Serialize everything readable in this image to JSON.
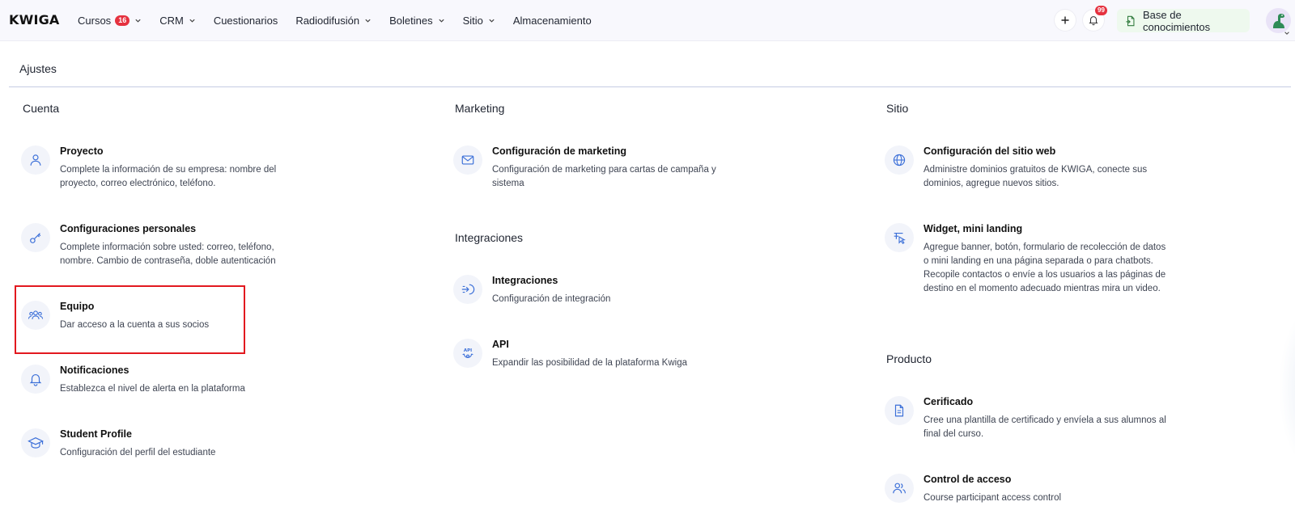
{
  "app": {
    "logo": "KWIGA"
  },
  "nav": {
    "items": [
      {
        "label": "Cursos",
        "badge": "16",
        "dropdown": true
      },
      {
        "label": "CRM",
        "dropdown": true
      },
      {
        "label": "Cuestionarios",
        "dropdown": false
      },
      {
        "label": "Radiodifusión",
        "dropdown": true
      },
      {
        "label": "Boletines",
        "dropdown": true
      },
      {
        "label": "Sitio",
        "dropdown": true
      },
      {
        "label": "Almacenamiento",
        "dropdown": false
      }
    ],
    "notifications_badge": "99",
    "knowledge_base_label": "Base de conocimientos"
  },
  "page": {
    "title": "Ajustes"
  },
  "sections": {
    "cuenta": {
      "title": "Cuenta",
      "items": [
        {
          "icon": "user-icon",
          "title": "Proyecto",
          "desc": "Complete la información de su empresa: nombre del proyecto, correo electrónico, teléfono."
        },
        {
          "icon": "key-icon",
          "title": "Configuraciones personales",
          "desc": "Complete información sobre usted: correo, teléfono, nombre. Cambio de contraseña, doble autenticación"
        },
        {
          "icon": "team-icon",
          "title": "Equipo",
          "desc": "Dar acceso a la cuenta a sus socios"
        },
        {
          "icon": "bell-icon",
          "title": "Notificaciones",
          "desc": "Establezca el nivel de alerta en la plataforma"
        },
        {
          "icon": "graduation-cap-icon",
          "title": "Student Profile",
          "desc": "Configuración del perfil del estudiante"
        }
      ]
    },
    "marketing": {
      "title": "Marketing",
      "items": [
        {
          "icon": "mail-icon",
          "title": "Configuración de marketing",
          "desc": "Configuración de marketing para cartas de campaña y sistema"
        }
      ]
    },
    "integraciones": {
      "title": "Integraciones",
      "items": [
        {
          "icon": "integration-icon",
          "title": "Integraciones",
          "desc": "Configuración de integración"
        },
        {
          "icon": "api-icon",
          "title": "API",
          "desc": "Expandir las posibilidad de la plataforma Kwiga"
        }
      ]
    },
    "sitio": {
      "title": "Sitio",
      "items": [
        {
          "icon": "globe-icon",
          "title": "Configuración del sitio web",
          "desc": "Administre dominios gratuitos de KWIGA, conecte sus dominios, agregue nuevos sitios."
        },
        {
          "icon": "widget-icon",
          "title": "Widget, mini landing",
          "desc": "Agregue banner, botón, formulario de recolección de datos o mini landing en una página separada o para chatbots. Recopile contactos o envíe a los usuarios a las páginas de destino en el momento adecuado mientras mira un video."
        }
      ]
    },
    "producto": {
      "title": "Producto",
      "items": [
        {
          "icon": "certificate-icon",
          "title": "Cerificado",
          "desc": "Cree una plantilla de certificado y envíela a sus alumnos al final del curso."
        },
        {
          "icon": "access-control-icon",
          "title": "Control de acceso",
          "desc": "Course participant access control"
        }
      ]
    }
  },
  "colors": {
    "accent": "#3b6fd8",
    "highlight": "#e2191f",
    "badge": "#e5313f",
    "kb_bg": "#eef9ee"
  }
}
